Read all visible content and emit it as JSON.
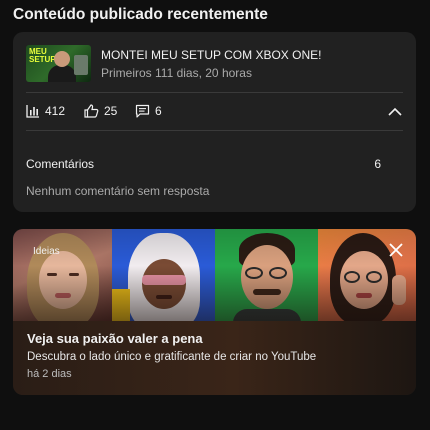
{
  "section": {
    "title": "Conteúdo publicado recentemente"
  },
  "video": {
    "thumbnail_text": "MEU SETUP",
    "title": "MONTEI MEU SETUP COM XBOX ONE!",
    "subtitle": "Primeiros 111 dias, 20 horas",
    "views": "412",
    "likes": "25",
    "comments": "6"
  },
  "comments_row": {
    "label": "Comentários",
    "count": "6",
    "empty_text": "Nenhum comentário sem resposta"
  },
  "promo": {
    "tag": "Ideias",
    "title": "Veja sua paixão valer a pena",
    "description": "Descubra o lado único e gratificante de criar no YouTube",
    "time": "há 2 dias"
  },
  "icons": {
    "views": "bar-chart-icon",
    "likes": "thumbs-up-icon",
    "comments": "comment-icon",
    "collapse": "chevron-up-icon",
    "close": "close-icon"
  },
  "colors": {
    "background": "#0f0f0f",
    "card": "#212121",
    "secondary_text": "#aaaaaa"
  }
}
